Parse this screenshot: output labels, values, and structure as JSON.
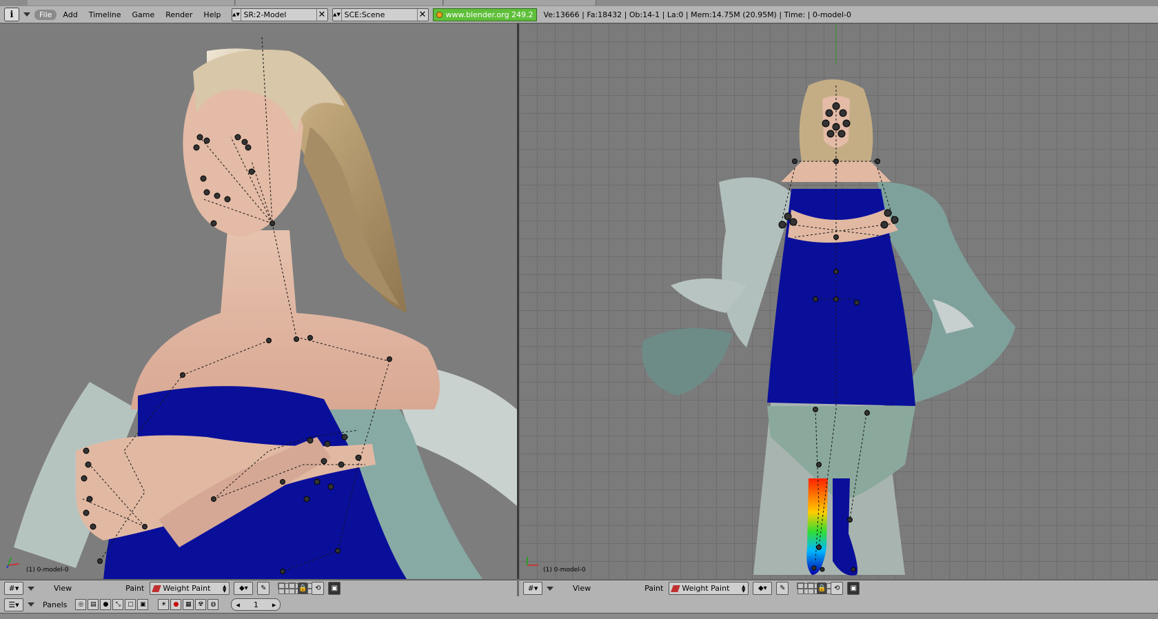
{
  "menubar": {
    "info_icon": "info-icon",
    "menus": [
      "File",
      "Add",
      "Timeline",
      "Game",
      "Render",
      "Help"
    ],
    "screen_field": "SR:2-Model",
    "scene_field": "SCE:Scene",
    "blender_link": "www.blender.org 249.2",
    "stats": "Ve:13666 | Fa:18432 | Ob:14-1 | La:0 | Mem:14.75M (20.95M) | Time: | 0-model-0"
  },
  "viewport_left": {
    "object_label": "(1) 0-model-0"
  },
  "viewport_right": {
    "object_label": "(1) 0-model-0"
  },
  "header_left": {
    "view_label": "View",
    "paint_label": "Paint",
    "mode_value": "Weight Paint"
  },
  "header_right": {
    "view_label": "View",
    "paint_label": "Paint",
    "mode_value": "Weight Paint"
  },
  "bottombar": {
    "panels_label": "Panels",
    "frame_value": "1"
  },
  "colors": {
    "dress": "#0a0f9a",
    "cloth": "#8aa9a6",
    "skin": "#e8c4b0",
    "hair": "#c4ad85",
    "blender_green": "#5fbf3a"
  }
}
